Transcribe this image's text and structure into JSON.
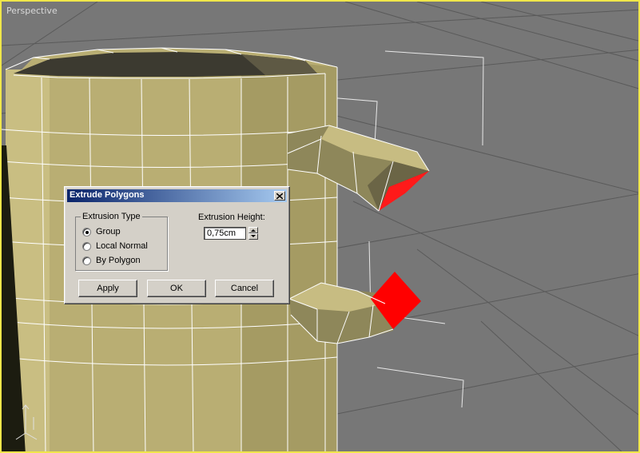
{
  "viewport": {
    "label": "Perspective",
    "border_color": "#f0e64a",
    "background": "#777777"
  },
  "scene": {
    "mug_color": "#b8ad72",
    "wire_color": "#ffffff",
    "selection_color": "#ff0000"
  },
  "dialog": {
    "title": "Extrude Polygons",
    "close_icon": "close-icon",
    "extrusion_type": {
      "label": "Extrusion Type",
      "options": [
        {
          "label": "Group",
          "checked": true
        },
        {
          "label": "Local Normal",
          "checked": false
        },
        {
          "label": "By Polygon",
          "checked": false
        }
      ]
    },
    "extrusion_height": {
      "label": "Extrusion Height:",
      "value": "0,75cm"
    },
    "buttons": {
      "apply": "Apply",
      "ok": "OK",
      "cancel": "Cancel"
    }
  }
}
